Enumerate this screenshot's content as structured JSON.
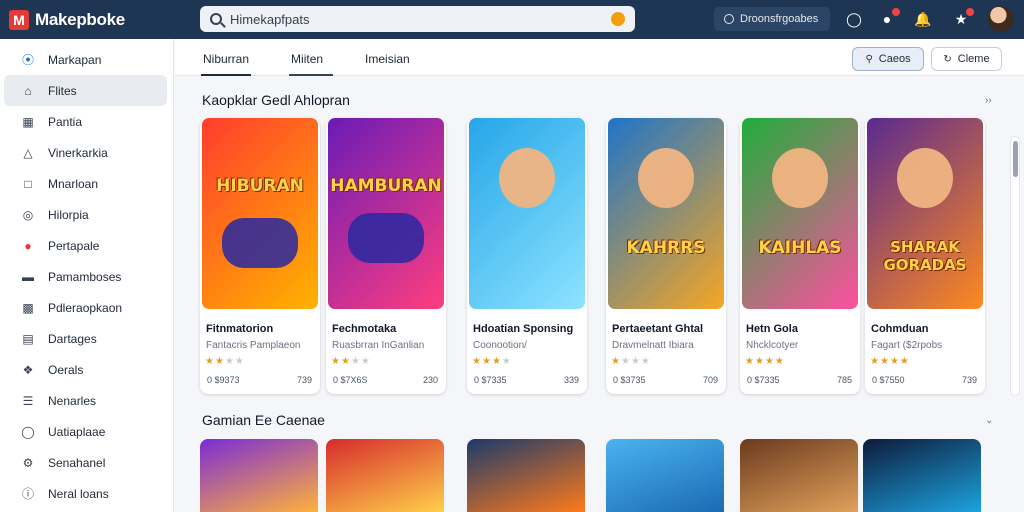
{
  "app": {
    "name": "Makepboke"
  },
  "search": {
    "value": "Himekapfpats"
  },
  "topbar": {
    "pill_label": "Droonsfrgoabes"
  },
  "sidebar": {
    "items": [
      {
        "label": "Markapan",
        "icon": "compass-icon"
      },
      {
        "label": "Flites",
        "icon": "home-icon"
      },
      {
        "label": "Pantia",
        "icon": "grid-icon"
      },
      {
        "label": "Vinerkarkia",
        "icon": "tag-icon"
      },
      {
        "label": "Mnarloan",
        "icon": "bookmark-icon"
      },
      {
        "label": "Hilorpia",
        "icon": "globe-icon"
      },
      {
        "label": "Pertapale",
        "icon": "fire-icon"
      },
      {
        "label": "Pamamboses",
        "icon": "folder-icon"
      },
      {
        "label": "Pdleraopkaon",
        "icon": "puzzle-icon"
      },
      {
        "label": "Dartages",
        "icon": "chart-icon"
      },
      {
        "label": "Oerals",
        "icon": "wrench-icon"
      },
      {
        "label": "Nenarles",
        "icon": "list-icon"
      },
      {
        "label": "Uatiaplaae",
        "icon": "circle-icon"
      },
      {
        "label": "Senahanel",
        "icon": "settings-icon"
      },
      {
        "label": "Neral loans",
        "icon": "info-icon"
      }
    ]
  },
  "tabs": [
    {
      "label": "Niburran"
    },
    {
      "label": "Miiten"
    },
    {
      "label": "Imeisian"
    }
  ],
  "buttons": {
    "primary": "Caeos",
    "secondary": "Cleme"
  },
  "sections": [
    {
      "title": "Kaopklar Gedl Ahlopran"
    },
    {
      "title": "Gamian Ee Caenae"
    }
  ],
  "cards": [
    {
      "title": "Fitnmatorion",
      "subtitle": "Fantacris Pamplaeon",
      "rating": 2,
      "left": "0 $9373",
      "right": "739",
      "art_text": "HIBURAN",
      "art_color_a": "#ff3d2e",
      "art_color_b": "#ffb300"
    },
    {
      "title": "Fechmotaka",
      "subtitle": "Ruasbrran InGanlian",
      "rating": 2,
      "left": "0 $7X6S",
      "right": "230",
      "art_text": "HAMBURAN",
      "art_color_a": "#6a1bb5",
      "art_color_b": "#ff3d7f"
    },
    {
      "title": "Hdoatian Sponsing",
      "subtitle": "Coonootion/",
      "rating": 3,
      "left": "0 $7335",
      "right": "339",
      "art_text": "",
      "art_color_a": "#25a6e8",
      "art_color_b": "#8ee3ff"
    },
    {
      "title": "Pertaeetant Ghtal",
      "subtitle": "Dravmelnatt Ibiara",
      "rating": 1,
      "left": "0 $3735",
      "right": "709",
      "art_text": "KAHRRS",
      "art_color_a": "#1f74c9",
      "art_color_b": "#f7a623"
    },
    {
      "title": "Hetn Gola",
      "subtitle": "Nhcklcotyer",
      "rating": 4,
      "left": "0 $7335",
      "right": "785",
      "art_text": "KAIHLAS",
      "art_color_a": "#1fae3a",
      "art_color_b": "#ff4fa0"
    },
    {
      "title": "Cohmduan",
      "subtitle": "Fagart ($2rpobs",
      "rating": 4,
      "left": "0 $7550",
      "right": "739",
      "art_text": "SHARAK GORADAS",
      "art_color_a": "#5a2a8f",
      "art_color_b": "#ff8a1f"
    }
  ],
  "bottom_cards": [
    {
      "color_a": "#7b2cd6",
      "color_b": "#ffb13b"
    },
    {
      "color_a": "#d62c2c",
      "color_b": "#ffcf4a"
    },
    {
      "color_a": "#1c3a6b",
      "color_b": "#ff7a1a"
    },
    {
      "color_a": "#4ab4f0",
      "color_b": "#1c6ab0"
    },
    {
      "color_a": "#6b3a1f",
      "color_b": "#e0a15a"
    },
    {
      "color_a": "#0d1b3a",
      "color_b": "#1ca3e0"
    }
  ]
}
